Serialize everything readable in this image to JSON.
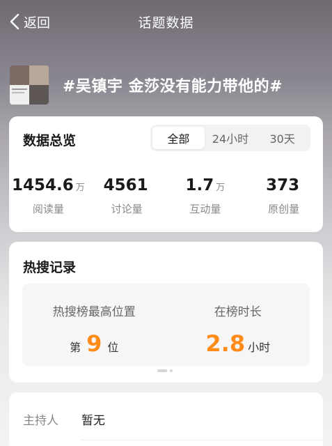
{
  "nav": {
    "back_label": "返回",
    "title": "话题数据"
  },
  "topic": {
    "title": "#吴镇宇 金莎没有能力带他的#"
  },
  "overview": {
    "title": "数据总览",
    "tabs": [
      {
        "label": "全部",
        "active": true
      },
      {
        "label": "24小时",
        "active": false
      },
      {
        "label": "30天",
        "active": false
      }
    ],
    "stats": [
      {
        "value": "1454.6",
        "unit": "万",
        "label": "阅读量"
      },
      {
        "value": "4561",
        "unit": "",
        "label": "讨论量"
      },
      {
        "value": "1.7",
        "unit": "万",
        "label": "互动量"
      },
      {
        "value": "373",
        "unit": "",
        "label": "原创量"
      }
    ]
  },
  "hot": {
    "title": "热搜记录",
    "rank": {
      "label": "热搜榜最高位置",
      "prefix": "第",
      "value": "9",
      "suffix": "位"
    },
    "duration": {
      "label": "在榜时长",
      "value": "2.8",
      "suffix": "小时"
    }
  },
  "host": {
    "label": "主持人",
    "value": "暂无"
  },
  "colors": {
    "accent": "#ff8c1a",
    "active_tab_bg": "#ffffff"
  }
}
